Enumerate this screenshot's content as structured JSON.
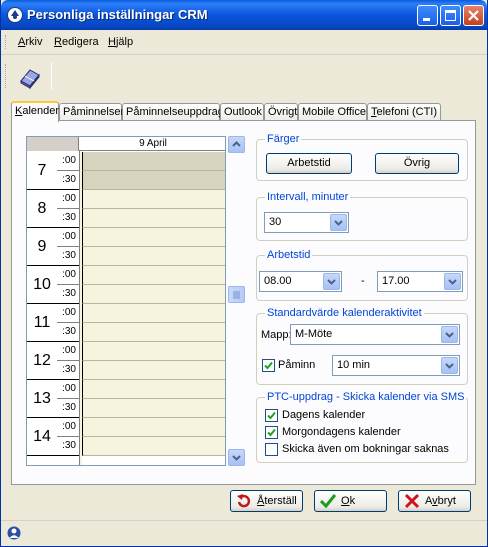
{
  "window": {
    "title": "Personliga inställningar CRM"
  },
  "menu": [
    {
      "label": "Arkiv",
      "ul": "A",
      "rest": "rkiv"
    },
    {
      "label": "Redigera",
      "ul": "R",
      "rest": "edigera"
    },
    {
      "label": "Hjälp",
      "ul": "H",
      "rest": "jälp"
    }
  ],
  "tabs": {
    "kalender": {
      "ul": "K",
      "rest": "alender"
    },
    "paminnelser": "Påminnelser",
    "paminnelseuppdrag": "Påminnelseuppdrag",
    "outlook": "Outlook",
    "ovrigt": "Övrigt",
    "mobile": "Mobile Office",
    "telefoni": {
      "ul": "T",
      "rest": "elefoni (CTI)"
    }
  },
  "calendar": {
    "date": "9 April",
    "hours": [
      "7",
      "8",
      "9",
      "10",
      "11",
      "12",
      "13",
      "14"
    ],
    "slot_top": ":00",
    "slot_bot": ":30"
  },
  "farger": {
    "title": "Färger",
    "arbetstid_btn": "Arbetstid",
    "ovrig_btn": "Övrig"
  },
  "intervall": {
    "title": "Intervall, minuter",
    "value": "30"
  },
  "arbetstid": {
    "title": "Arbetstid",
    "from": "08.00",
    "dash": "-",
    "to": "17.00"
  },
  "standard": {
    "title": "Standardvärde kalenderaktivitet",
    "mapp_label": "Mapp:",
    "mapp_value": "M-Möte",
    "paminn_label": "Påminn",
    "paminn_value": "10 min"
  },
  "ptc": {
    "title": "PTC-uppdrag - Skicka kalender via SMS",
    "dagens": "Dagens kalender",
    "morgondagens": "Morgondagens kalender",
    "skicka": "Skicka även om bokningar saknas"
  },
  "buttons": {
    "aterstall": {
      "ul": "Å",
      "rest": "terställ"
    },
    "ok": {
      "ul": "O",
      "rest": "k"
    },
    "avbryt": {
      "pre": "A",
      "ul": "v",
      "rest": "bryt"
    }
  }
}
